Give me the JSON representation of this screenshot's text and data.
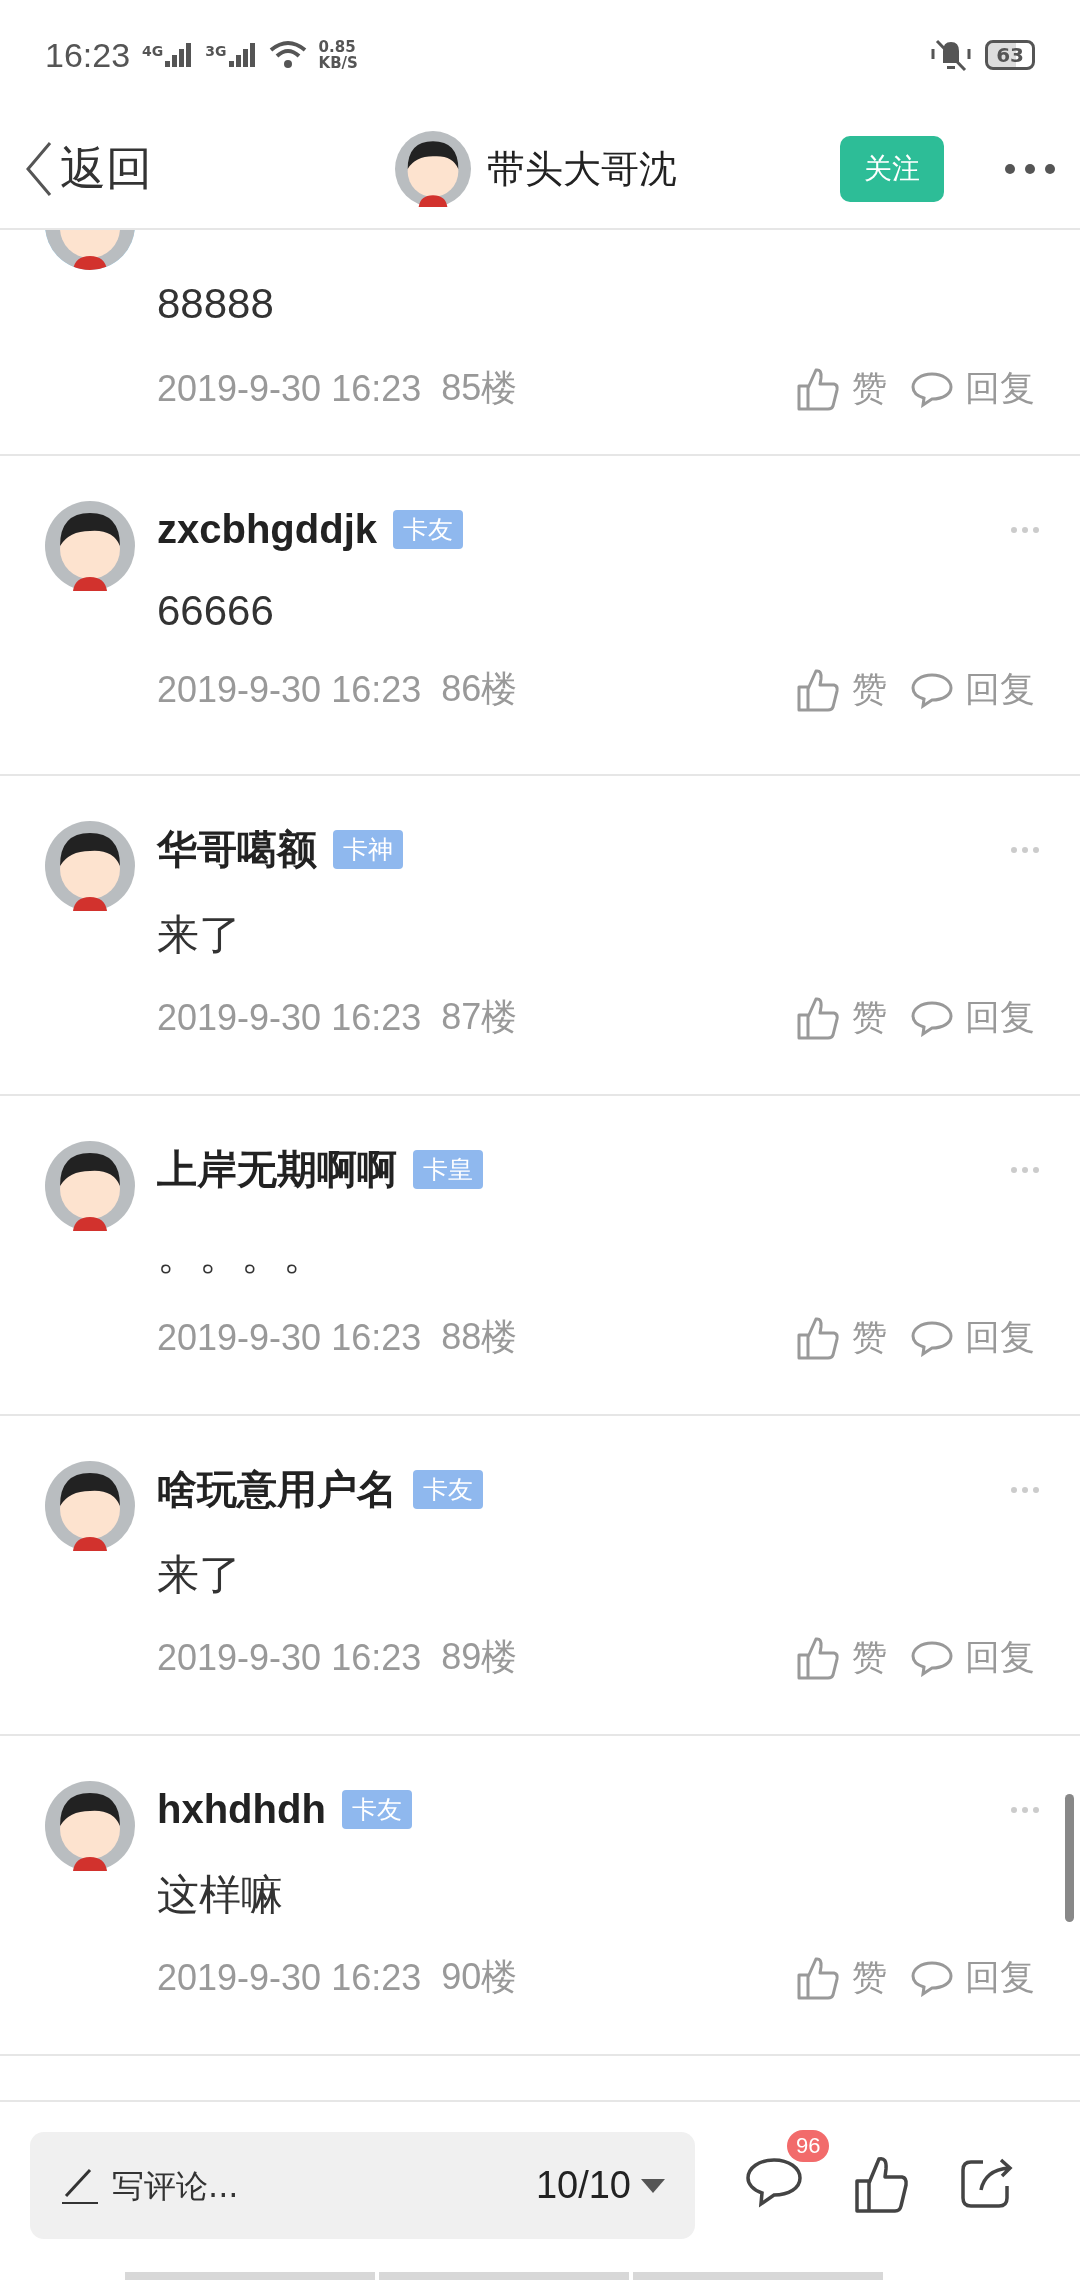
{
  "status_bar": {
    "time": "16:23",
    "network_1": "4G",
    "network_2": "3G",
    "speed_value": "0.85",
    "speed_unit": "KB/S",
    "battery": "63"
  },
  "header": {
    "back": "返回",
    "title": "带头大哥沈",
    "follow": "关注"
  },
  "comments": [
    {
      "kind": "partial",
      "content": "88888",
      "time": "2019-9-30 16:23",
      "floor": "85楼",
      "like": "赞",
      "reply": "回复"
    },
    {
      "kind": "full",
      "user": "zxcbhgddjk",
      "badge": "卡友",
      "content": "66666",
      "time": "2019-9-30 16:23",
      "floor": "86楼",
      "like": "赞",
      "reply": "回复"
    },
    {
      "kind": "full",
      "user": "华哥噶额",
      "badge": "卡神",
      "content": "来了",
      "time": "2019-9-30 16:23",
      "floor": "87楼",
      "like": "赞",
      "reply": "回复"
    },
    {
      "kind": "full",
      "user": "上岸无期啊啊",
      "badge": "卡皇",
      "content": "。。。。",
      "time": "2019-9-30 16:23",
      "floor": "88楼",
      "like": "赞",
      "reply": "回复"
    },
    {
      "kind": "full",
      "user": "啥玩意用户名",
      "badge": "卡友",
      "content": "来了",
      "time": "2019-9-30 16:23",
      "floor": "89楼",
      "like": "赞",
      "reply": "回复"
    },
    {
      "kind": "full",
      "user": "hxhdhdh",
      "badge": "卡友",
      "content": "这样嘛",
      "time": "2019-9-30 16:23",
      "floor": "90楼",
      "like": "赞",
      "reply": "回复"
    }
  ],
  "bottom_bar": {
    "placeholder": "写评论...",
    "page": "10/10",
    "comment_count": "96"
  }
}
